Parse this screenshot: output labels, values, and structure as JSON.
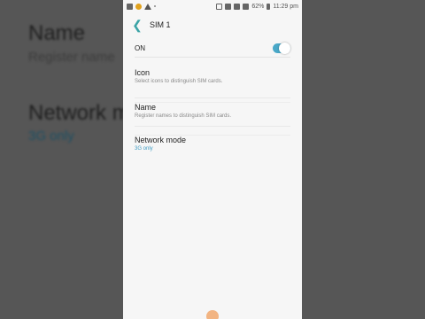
{
  "background": {
    "name_title": "Name",
    "name_sub": "Register name",
    "network_title": "Network m",
    "network_sub": "3G only"
  },
  "statusbar": {
    "battery": "62%",
    "time": "11:29 pm"
  },
  "appbar": {
    "back_icon": "back-arrow",
    "title": "SIM 1"
  },
  "settings": {
    "on_label": "ON",
    "on_state": true,
    "items": [
      {
        "title": "Icon",
        "subtitle": "Select icons to distinguish SIM cards."
      },
      {
        "title": "Name",
        "subtitle": "Register names to distinguish SIM cards."
      },
      {
        "title": "Network mode",
        "subtitle": "3G only"
      }
    ]
  },
  "colors": {
    "accent": "#3aa3a6",
    "toggle": "#49a8c8",
    "subtitle_accent": "#3f9cc3"
  }
}
